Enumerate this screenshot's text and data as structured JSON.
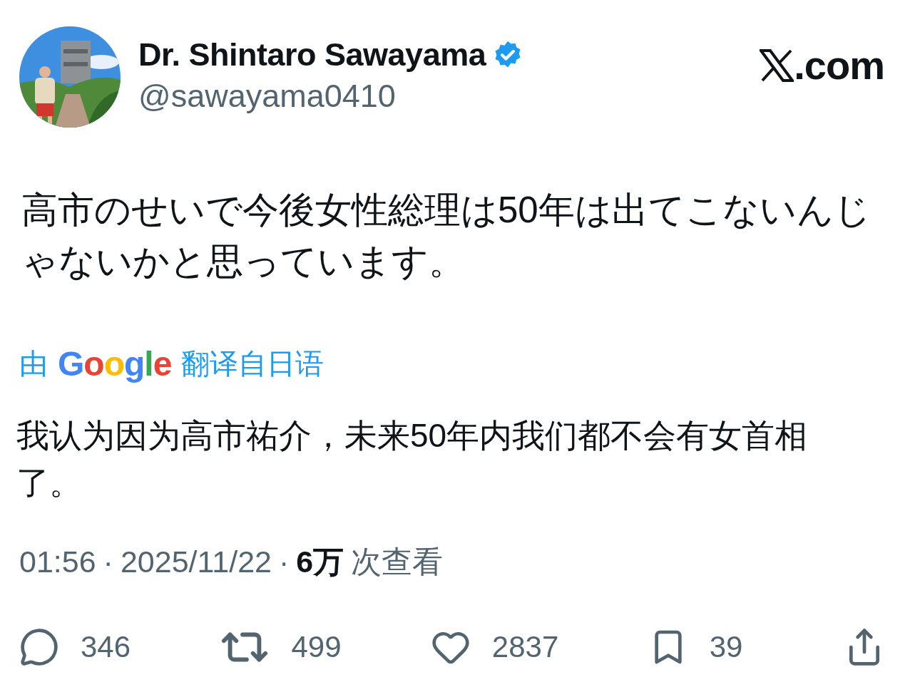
{
  "author": {
    "name": "Dr. Shintaro Sawayama",
    "verified": true,
    "handle": "@sawayama0410"
  },
  "site": {
    "suffix": ".com"
  },
  "tweet": {
    "text": "高市のせいで今後女性総理は50年は出てこないんじゃないかと思っています。"
  },
  "translation": {
    "prefix": "由",
    "provider": "Google",
    "label": "翻译自日语",
    "text": "我认为因为高市祐介，未来50年内我们都不会有女首相了。"
  },
  "meta": {
    "time": "01:56",
    "separator_1": "·",
    "date": "2025/11/22",
    "separator_2": "·",
    "views": "6万",
    "views_label": "次查看"
  },
  "actions": [
    {
      "kind": "reply",
      "count": "346"
    },
    {
      "kind": "repost",
      "count": "499"
    },
    {
      "kind": "like",
      "count": "2837"
    },
    {
      "kind": "bookmark",
      "count": "39"
    },
    {
      "kind": "share"
    }
  ]
}
